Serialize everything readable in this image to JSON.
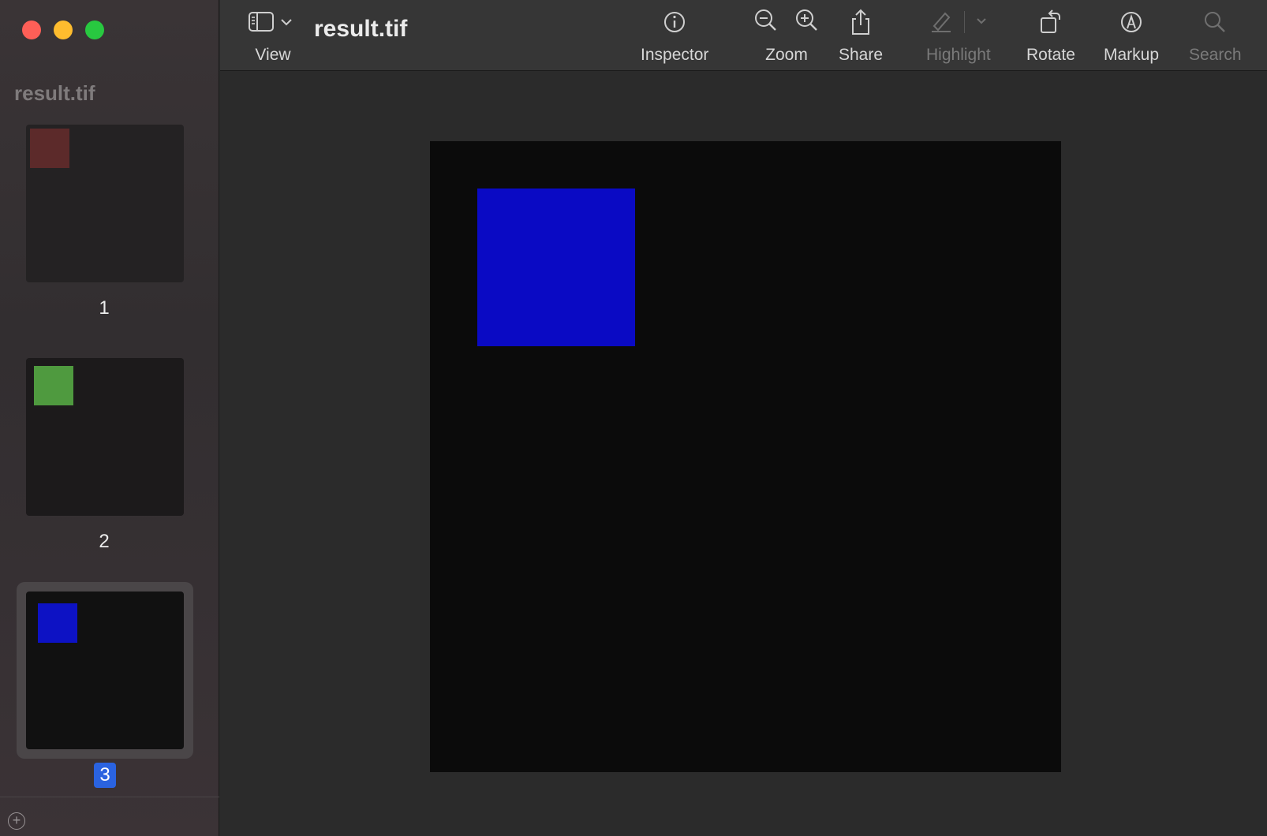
{
  "window": {
    "title": "result.tif"
  },
  "sidebar": {
    "title": "result.tif",
    "pages": [
      {
        "number": "1",
        "square_color": "#5c2a2a",
        "bg_color": "#242223"
      },
      {
        "number": "2",
        "square_color": "#4f9a3f",
        "bg_color": "#1c1a1b"
      },
      {
        "number": "3",
        "square_color": "#0d12c4",
        "bg_color": "#111111"
      }
    ],
    "selected_page": "3"
  },
  "toolbar": {
    "view": "View",
    "inspector": "Inspector",
    "zoom": "Zoom",
    "share": "Share",
    "highlight": "Highlight",
    "rotate": "Rotate",
    "markup": "Markup",
    "search": "Search"
  },
  "canvas": {
    "square_color": "#0a0ac4",
    "page_bg": "#0b0b0b"
  }
}
